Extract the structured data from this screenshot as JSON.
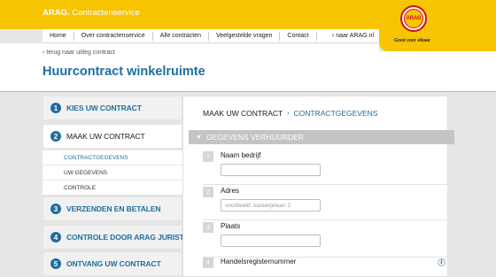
{
  "header": {
    "brand_bold": "ARAG.",
    "brand_text": "Contractenservice",
    "nav": [
      "Home",
      "Over contractenservice",
      "Alle contracten",
      "Veelgestelde vragen",
      "Contact"
    ],
    "external_link": "› naar ARAG.nl",
    "logo_text": "ARAG",
    "logo_tagline": "Goed voor elkaar",
    "colors": {
      "accent": "#f6c400",
      "blue": "#1e6e9f",
      "logo_red": "#d40f14"
    }
  },
  "page": {
    "back_link": "‹ terug naar uitleg contract",
    "title": "Huurcontract winkelruimte"
  },
  "sidebar": {
    "steps": [
      {
        "number": "1",
        "label": "KIES UW CONTRACT",
        "active": false
      },
      {
        "number": "2",
        "label": "MAAK UW CONTRACT",
        "active": true
      },
      {
        "number": "3",
        "label": "VERZENDEN EN BETALEN",
        "active": false
      },
      {
        "number": "4",
        "label": "CONTROLE DOOR ARAG JURIST",
        "active": false
      },
      {
        "number": "5",
        "label": "ONTVANG UW CONTRACT",
        "active": false
      }
    ],
    "substeps": [
      {
        "label": "CONTRACTGEGEVENS",
        "current": true
      },
      {
        "label": "UW GEGEVENS",
        "current": false
      },
      {
        "label": "CONTROLE",
        "current": false
      }
    ]
  },
  "main": {
    "breadcrumb": {
      "first": "MAAK UW CONTRACT",
      "separator": "›",
      "second": "CONTRACTGEGEVENS"
    },
    "section": {
      "chevron": "▼",
      "title": "GEGEVENS VERHUURDER"
    },
    "fields": [
      {
        "number": "1",
        "label": "Naam bedrijf",
        "value": "",
        "placeholder": ""
      },
      {
        "number": "2",
        "label": "Adres",
        "value": "",
        "placeholder": "voorbeeld: kastanjelaan 2"
      },
      {
        "number": "3",
        "label": "Plaats",
        "value": "",
        "placeholder": ""
      },
      {
        "number": "4",
        "label": "Handelsregisternummer",
        "value": "",
        "placeholder": ""
      }
    ],
    "info_icon": "i"
  }
}
